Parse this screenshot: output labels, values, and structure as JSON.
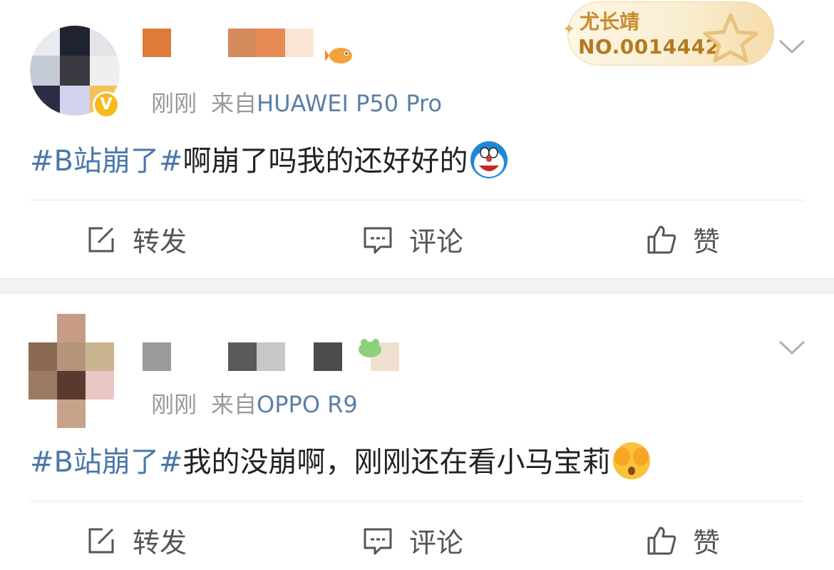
{
  "gold_card": {
    "name": "尤长靖",
    "number": "NO.0014442"
  },
  "posts": [
    {
      "time": "刚刚",
      "from_label": "来自",
      "device": "HUAWEI P50 Pro",
      "topic": "#B站崩了#",
      "text": "啊崩了吗我的还好好的",
      "text_emoji": "doraemon-emoji",
      "verified": "V",
      "actions": {
        "repost": "转发",
        "comment": "评论",
        "like": "赞"
      }
    },
    {
      "time": "刚刚",
      "from_label": "来自",
      "device": "OPPO R9",
      "topic": "#B站崩了#",
      "text": "我的没崩啊，刚刚还在看小马宝莉",
      "text_emoji": "cover-face-emoji",
      "actions": {
        "repost": "转发",
        "comment": "评论",
        "like": "赞"
      }
    }
  ],
  "icons": {
    "repost": "edit-square-icon",
    "comment": "comment-bubble-icon",
    "like": "thumbs-up-icon",
    "menu": "chevron-down-icon"
  },
  "colors": {
    "topic": "#4a78a8",
    "device": "#5b7fa6",
    "meta": "#999999",
    "verified": "#f8b91c",
    "gold_text": "#c98b2e"
  }
}
